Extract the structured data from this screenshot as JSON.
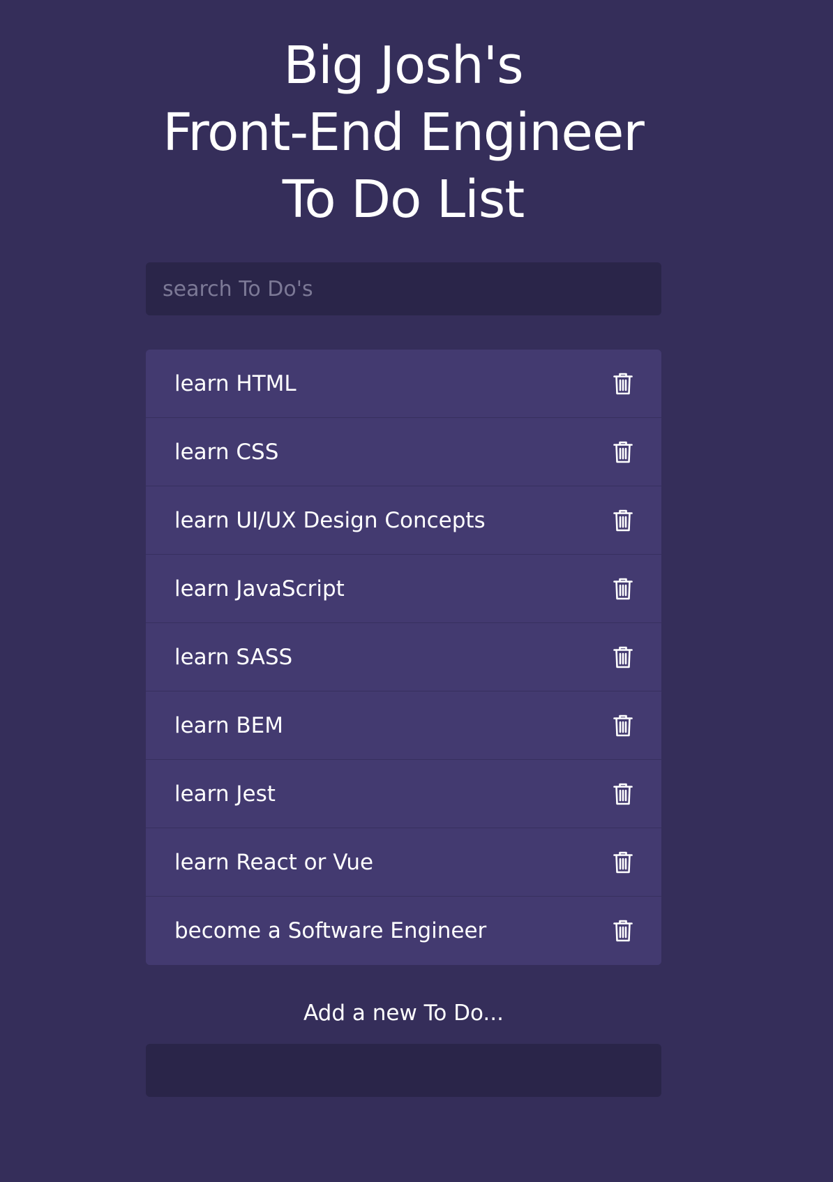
{
  "header": {
    "title_lines": [
      "Big Josh's",
      "Front-End Engineer",
      "To Do List"
    ]
  },
  "search": {
    "placeholder": "search To Do's",
    "value": ""
  },
  "todos": [
    {
      "label": "learn HTML",
      "icon": "trash-icon"
    },
    {
      "label": "learn CSS",
      "icon": "trash-icon"
    },
    {
      "label": "learn UI/UX Design Concepts",
      "icon": "trash-icon"
    },
    {
      "label": "learn JavaScript",
      "icon": "trash-icon"
    },
    {
      "label": "learn SASS",
      "icon": "trash-icon"
    },
    {
      "label": "learn BEM",
      "icon": "trash-icon"
    },
    {
      "label": "learn Jest",
      "icon": "trash-icon"
    },
    {
      "label": "learn React or Vue",
      "icon": "trash-icon"
    },
    {
      "label": "become a Software Engineer",
      "icon": "trash-icon"
    }
  ],
  "add": {
    "label": "Add a new To Do...",
    "value": ""
  },
  "colors": {
    "background": "#352e5a",
    "input_background": "#2a2549",
    "list_item_background": "#433a70",
    "text": "#ffffff"
  }
}
